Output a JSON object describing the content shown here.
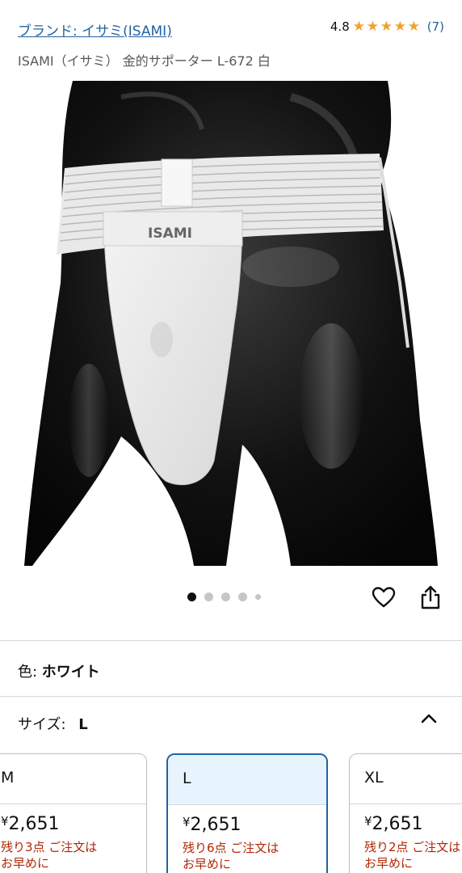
{
  "brand": {
    "link_text": "ブランド: イサミ(ISAMI)"
  },
  "rating": {
    "value": "4.8",
    "stars": 5,
    "count": "(7)"
  },
  "product": {
    "title": "ISAMI（イサミ） 金的サポーター L-672 白"
  },
  "gallery": {
    "image_text": "ISAMI",
    "dots_count": 5,
    "active_dot": 0
  },
  "actions": {
    "wishlist_icon": "heart-icon",
    "share_icon": "share-icon"
  },
  "variations": {
    "color_label": "色: ",
    "color_value": "ホワイト",
    "size_label": "サイズ: ",
    "size_value": "L"
  },
  "size_options": [
    {
      "size": "M",
      "currency": "¥",
      "price": "2,651",
      "stock_line1": "残り3点 ご注文は",
      "stock_line2": "お早めに"
    },
    {
      "size": "L",
      "currency": "¥",
      "price": "2,651",
      "stock_line1": "残り6点 ご注文は",
      "stock_line2": "お早めに"
    },
    {
      "size": "XL",
      "currency": "¥",
      "price": "2,651",
      "stock_line1": "残り2点 ご注文は",
      "stock_line2": "お早めに"
    }
  ],
  "colors": {
    "link": "#2162a1",
    "star": "#f0a12c",
    "stock": "#b12704",
    "selected_border": "#2162a1"
  }
}
